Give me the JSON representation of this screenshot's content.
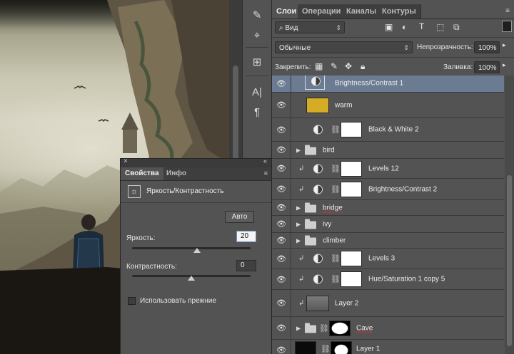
{
  "layers_panel": {
    "tabs": [
      {
        "label": "Слои",
        "active": true
      },
      {
        "label": "Операции",
        "active": false
      },
      {
        "label": "Каналы",
        "active": false
      },
      {
        "label": "Контуры",
        "active": false
      }
    ],
    "filter_kind": "Вид",
    "blend_mode": "Обычные",
    "opacity_label": "Непрозрачность:",
    "opacity_value": "100%",
    "lock_label": "Закрепить:",
    "fill_label": "Заливка:",
    "fill_value": "100%",
    "layers": [
      {
        "name": "Brightness/Contrast 1",
        "type": "adjustment",
        "selected": true
      },
      {
        "name": "warm",
        "type": "fill",
        "color": "#d4ac26"
      },
      {
        "name": "Black & White 2",
        "type": "adjustment-mask"
      },
      {
        "name": "bird",
        "type": "group"
      },
      {
        "name": "Levels 12",
        "type": "adjustment-mask",
        "clipped": true
      },
      {
        "name": "Brightness/Contrast 2",
        "type": "adjustment-mask",
        "clipped": true
      },
      {
        "name": "bridge",
        "type": "group",
        "underlined": true
      },
      {
        "name": "ivy",
        "type": "group"
      },
      {
        "name": "climber",
        "type": "group"
      },
      {
        "name": "Levels 3",
        "type": "adjustment-mask",
        "clipped": true
      },
      {
        "name": "Hue/Saturation 1 copy 5",
        "type": "adjustment-mask",
        "clipped": true
      },
      {
        "name": "Layer 2",
        "type": "pixel",
        "clipped": true
      },
      {
        "name": "Cave",
        "type": "group-mask",
        "underlined": true
      },
      {
        "name": "Layer 1",
        "type": "pixel-mask"
      }
    ]
  },
  "properties_panel": {
    "tabs": [
      {
        "label": "Свойства",
        "active": true
      },
      {
        "label": "Инфо",
        "active": false
      }
    ],
    "title": "Яркость/Контрастность",
    "auto_label": "Авто",
    "brightness_label": "Яркость:",
    "brightness_value": "20",
    "brightness_level": 0.55,
    "contrast_label": "Контрастность:",
    "contrast_value": "0",
    "contrast_level": 0.5,
    "legacy_label": "Использовать прежние",
    "legacy_checked": false
  },
  "tools": [
    "brush-presets-icon",
    "clone-source-icon",
    "tool-presets-icon",
    "character-icon",
    "paragraph-icon"
  ],
  "colors": {
    "panel": "#535353",
    "selected_row": "#6a7b92",
    "warm_fill": "#d4ac26"
  }
}
